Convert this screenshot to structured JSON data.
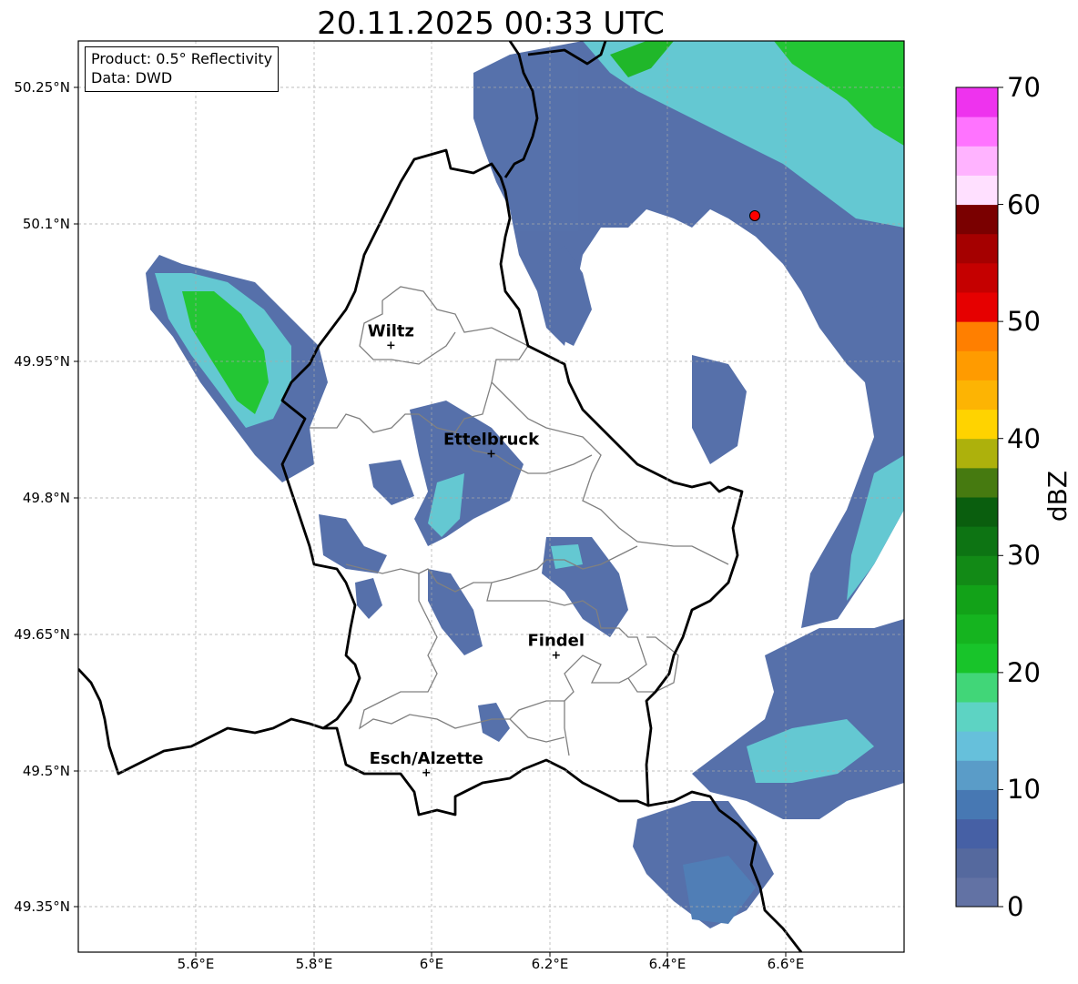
{
  "title": "20.11.2025 00:33 UTC",
  "product_box": {
    "product_line": "Product: 0.5° Reflectivity",
    "data_line": "Data: DWD"
  },
  "y_ticks": [
    "50.25°N",
    "50.1°N",
    "49.95°N",
    "49.8°N",
    "49.65°N",
    "49.5°N",
    "49.35°N"
  ],
  "x_ticks": [
    "5.6°E",
    "5.8°E",
    "6°E",
    "6.2°E",
    "6.4°E",
    "6.6°E"
  ],
  "extent": {
    "lon_min": 5.4,
    "lon_max": 6.8,
    "lat_min": 49.3,
    "lat_max": 50.3
  },
  "cities": [
    {
      "name": "Wiltz",
      "lon": 5.93,
      "lat": 49.966
    },
    {
      "name": "Ettelbruck",
      "lon": 6.1,
      "lat": 49.847
    },
    {
      "name": "Findel",
      "lon": 6.21,
      "lat": 49.626
    },
    {
      "name": "Esch/Alzette",
      "lon": 5.99,
      "lat": 49.497
    }
  ],
  "radar_site": {
    "lon": 6.55,
    "lat": 50.11,
    "color": "#ff0000"
  },
  "colorbar": {
    "label": "dBZ",
    "min": 0,
    "max": 70,
    "ticks": [
      "70",
      "60",
      "50",
      "40",
      "30",
      "20",
      "10",
      "0"
    ],
    "colors_bottom_to_top": [
      "#6272a4",
      "#55699e",
      "#4660a5",
      "#4778b3",
      "#5a9cc8",
      "#66c0db",
      "#5dd3c3",
      "#41d678",
      "#18c42a",
      "#15b41f",
      "#12a218",
      "#128a16",
      "#0d7413",
      "#0a5e0e",
      "#467a10",
      "#adb10c",
      "#ffd300",
      "#fdb403",
      "#ff9b00",
      "#ff7f00",
      "#e60000",
      "#c50000",
      "#a50000",
      "#7a0000",
      "#ffe0ff",
      "#ffb3ff",
      "#ff73ff",
      "#ee33ee"
    ]
  }
}
